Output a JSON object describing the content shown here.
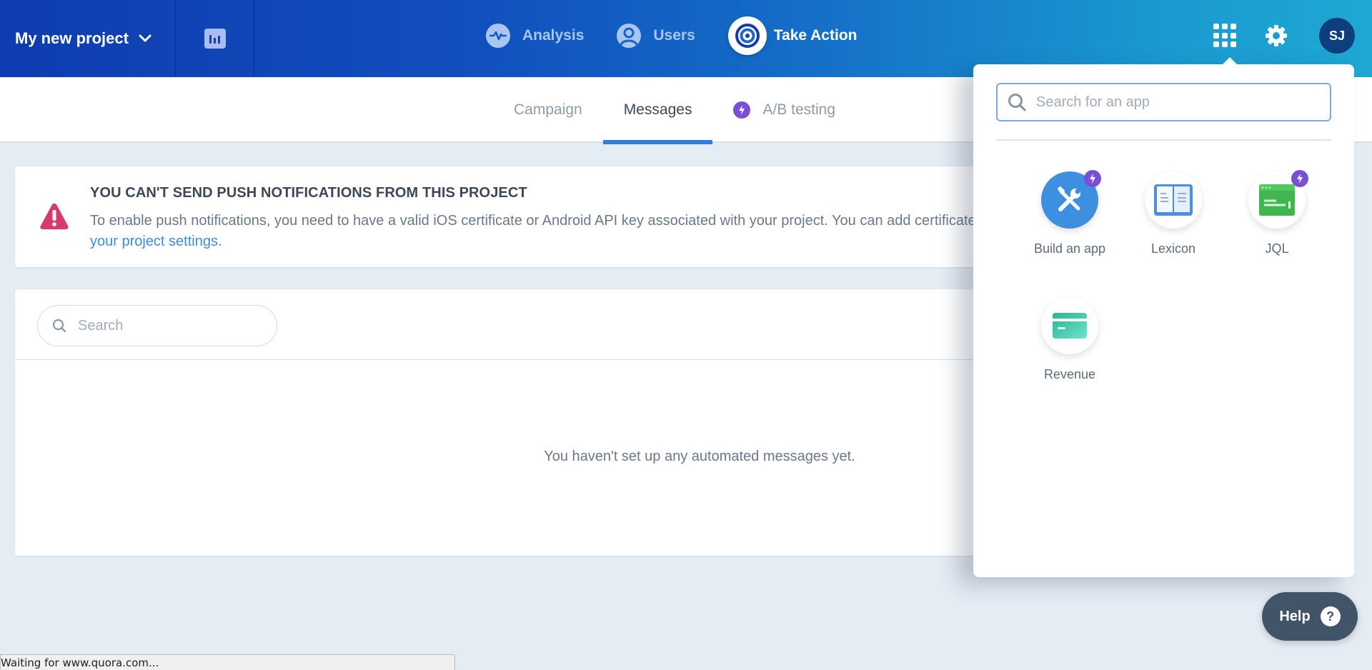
{
  "topbar": {
    "project_name": "My new project",
    "nav": [
      {
        "label": "Analysis",
        "icon": "activity-icon",
        "active": false
      },
      {
        "label": "Users",
        "icon": "user-icon",
        "active": false
      },
      {
        "label": "Take Action",
        "icon": "target-icon",
        "active": true
      }
    ],
    "avatar_initials": "SJ"
  },
  "subtabs": [
    {
      "label": "Campaign",
      "active": false
    },
    {
      "label": "Messages",
      "active": true
    },
    {
      "label": "A/B testing",
      "active": false,
      "badge": "bolt-icon"
    }
  ],
  "alert": {
    "title": "YOU CAN'T SEND PUSH NOTIFICATIONS FROM THIS PROJECT",
    "body_prefix": "To enable push notifications, you need to have a valid iOS certificate or Android API key associated with your project. You can add certificates in ",
    "link_text": "your project settings",
    "body_suffix": "."
  },
  "messages": {
    "search_placeholder": "Search",
    "empty_text": "You haven't set up any automated messages yet."
  },
  "apps_popover": {
    "search_placeholder": "Search for an app",
    "apps": [
      {
        "label": "Build an app",
        "icon": "tools-icon",
        "premium": true
      },
      {
        "label": "Lexicon",
        "icon": "book-icon",
        "premium": false
      },
      {
        "label": "JQL",
        "icon": "code-window-icon",
        "premium": true
      },
      {
        "label": "Revenue",
        "icon": "credit-card-icon",
        "premium": false
      }
    ]
  },
  "help": {
    "label": "Help"
  },
  "status_bar": {
    "text": "Waiting for www.quora.com..."
  },
  "colors": {
    "active_tab": "#2f7ed8",
    "premium_badge": "#7a4fd6",
    "warning": "#d63a6e",
    "link": "#3a8fd6"
  }
}
